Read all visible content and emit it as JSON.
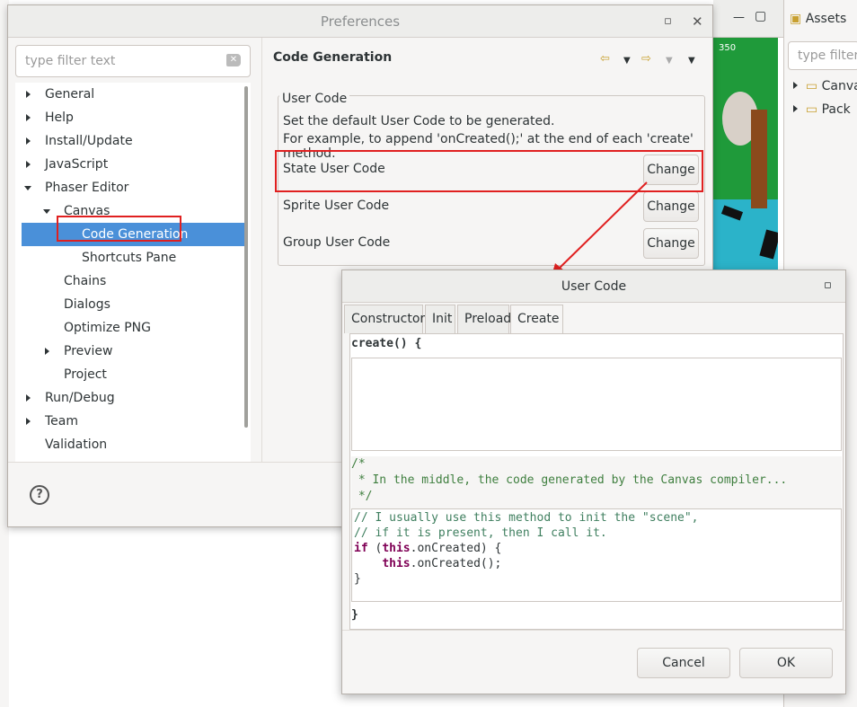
{
  "background_app": {
    "score_text": "350",
    "assets_panel": {
      "title": "Assets",
      "filter_placeholder": "type filter",
      "items": [
        "Canva",
        "Pack"
      ]
    }
  },
  "preferences": {
    "title": "Preferences",
    "filter_placeholder": "type filter text",
    "tree": [
      {
        "label": "General"
      },
      {
        "label": "Help"
      },
      {
        "label": "Install/Update"
      },
      {
        "label": "JavaScript"
      },
      {
        "label": "Phaser Editor"
      },
      {
        "label": "Canvas"
      },
      {
        "label": "Code Generation"
      },
      {
        "label": "Shortcuts Pane"
      },
      {
        "label": "Chains"
      },
      {
        "label": "Dialogs"
      },
      {
        "label": "Optimize PNG"
      },
      {
        "label": "Preview"
      },
      {
        "label": "Project"
      },
      {
        "label": "Run/Debug"
      },
      {
        "label": "Team"
      },
      {
        "label": "Validation"
      }
    ],
    "page_title": "Code Generation",
    "group_label": "User Code",
    "description_1": "Set the default User Code to be generated.",
    "description_2": "For example, to append 'onCreated();' at the end of each 'create' method.",
    "rows": [
      {
        "label": "State User Code",
        "button": "Change"
      },
      {
        "label": "Sprite User Code",
        "button": "Change"
      },
      {
        "label": "Group User Code",
        "button": "Change"
      }
    ],
    "help_label": "?"
  },
  "user_code_dialog": {
    "title": "User Code",
    "tabs": [
      "Constructor",
      "Init",
      "Preload",
      "Create"
    ],
    "active_tab": "Create",
    "code_header": "create() {",
    "comment_lines": [
      "/*",
      " * In the middle, the code generated by the Canvas compiler...",
      " */"
    ],
    "code_lines": [
      "// I usually use this method to init the \"scene\",",
      "// if it is present, then I call it.",
      "if (this.onCreated) {",
      "    this.onCreated();",
      "}"
    ],
    "code_footer": "}",
    "cancel_label": "Cancel",
    "ok_label": "OK"
  },
  "colors": {
    "accent": "#4a90d9",
    "highlight": "#e02020"
  }
}
